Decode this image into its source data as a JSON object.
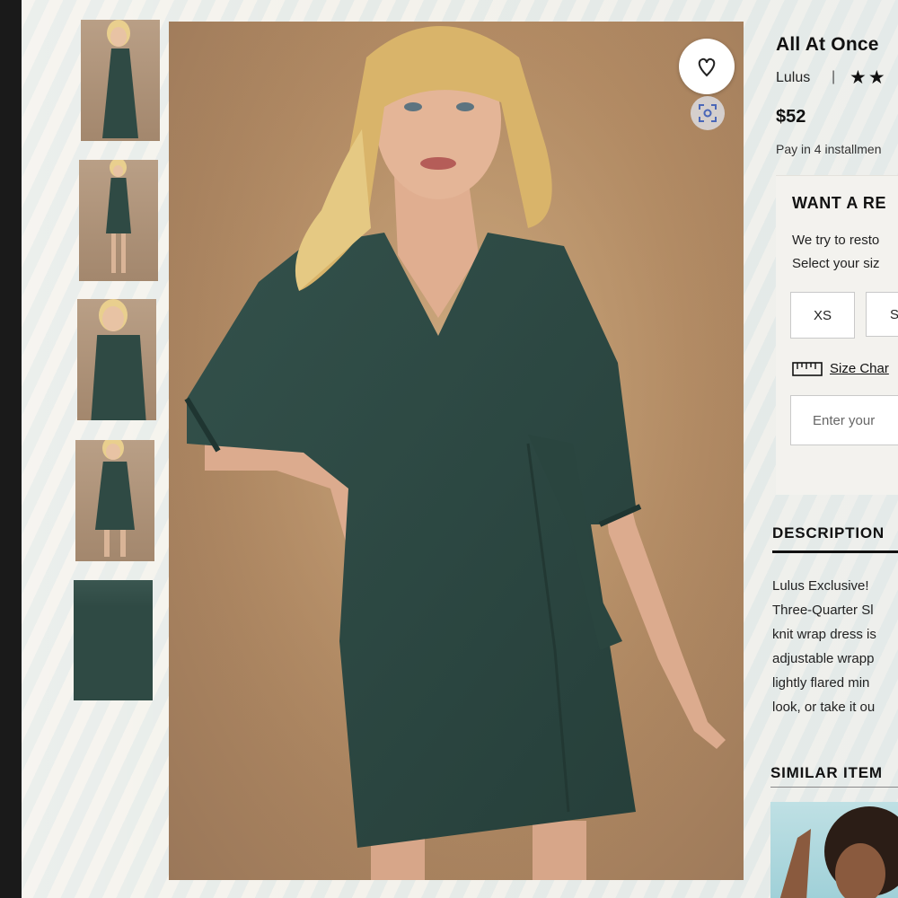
{
  "product": {
    "title": "All At Once",
    "brand": "Lulus",
    "brand_separator": "|",
    "rating_stars": "★★",
    "price": "$52",
    "installments": "Pay in 4 installmen"
  },
  "gallery": {
    "thumbnail_count": 5,
    "main_image_alt": "Model wearing dark green wrap dress",
    "favorite_icon": "heart-outline-icon",
    "visual_search_icon": "scan-icon"
  },
  "restock": {
    "title": "WANT A RE",
    "line1": "We try to resto",
    "line2": "Select your siz",
    "sizes": [
      "XS",
      "S"
    ],
    "size_chart_label": "Size Char",
    "email_placeholder": "Enter your"
  },
  "description": {
    "heading": "DESCRIPTION",
    "lines": [
      "Lulus Exclusive! ",
      "Three-Quarter Sl",
      "knit wrap dress is",
      "adjustable wrapp",
      "lightly flared min",
      "look, or take it ou"
    ]
  },
  "similar": {
    "heading": "SIMILAR ITEM"
  },
  "colors": {
    "dress": "#2f4a44",
    "background": "#b38b63",
    "text": "#111111"
  }
}
